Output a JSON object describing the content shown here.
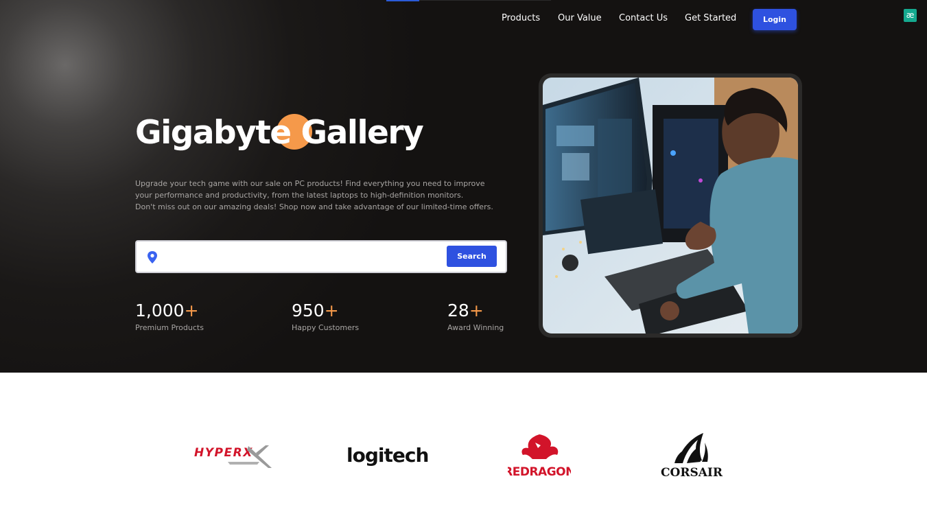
{
  "nav": {
    "links": [
      "Products",
      "Our Value",
      "Contact Us",
      "Get Started"
    ],
    "login_label": "Login",
    "ae_icon_label": "æ"
  },
  "hero": {
    "title": "Gigabyte Gallery",
    "description_lines": [
      "Upgrade your tech game with our sale on PC products! Find everything you need to improve",
      "your performance and productivity, from the latest laptops to high-definition monitors.",
      "Don't miss out on our amazing deals! Shop now and take advantage of our limited-time offers."
    ],
    "search": {
      "placeholder": "",
      "button_label": "Search",
      "icon": "location-pin-icon"
    },
    "stats": [
      {
        "value": "1,000",
        "suffix": "+",
        "label": "Premium Products"
      },
      {
        "value": "950",
        "suffix": "+",
        "label": "Happy Customers"
      },
      {
        "value": "28",
        "suffix": "+",
        "label": "Award Winning"
      }
    ]
  },
  "brands": [
    {
      "name": "HYPERX"
    },
    {
      "name": "logitech"
    },
    {
      "name": "REDRAGON"
    },
    {
      "name": "CORSAIR"
    }
  ],
  "colors": {
    "accent_blue": "#2e51e0",
    "accent_orange": "#f5994a",
    "hero_bg": "#141211",
    "ae_badge": "#15a98f"
  }
}
